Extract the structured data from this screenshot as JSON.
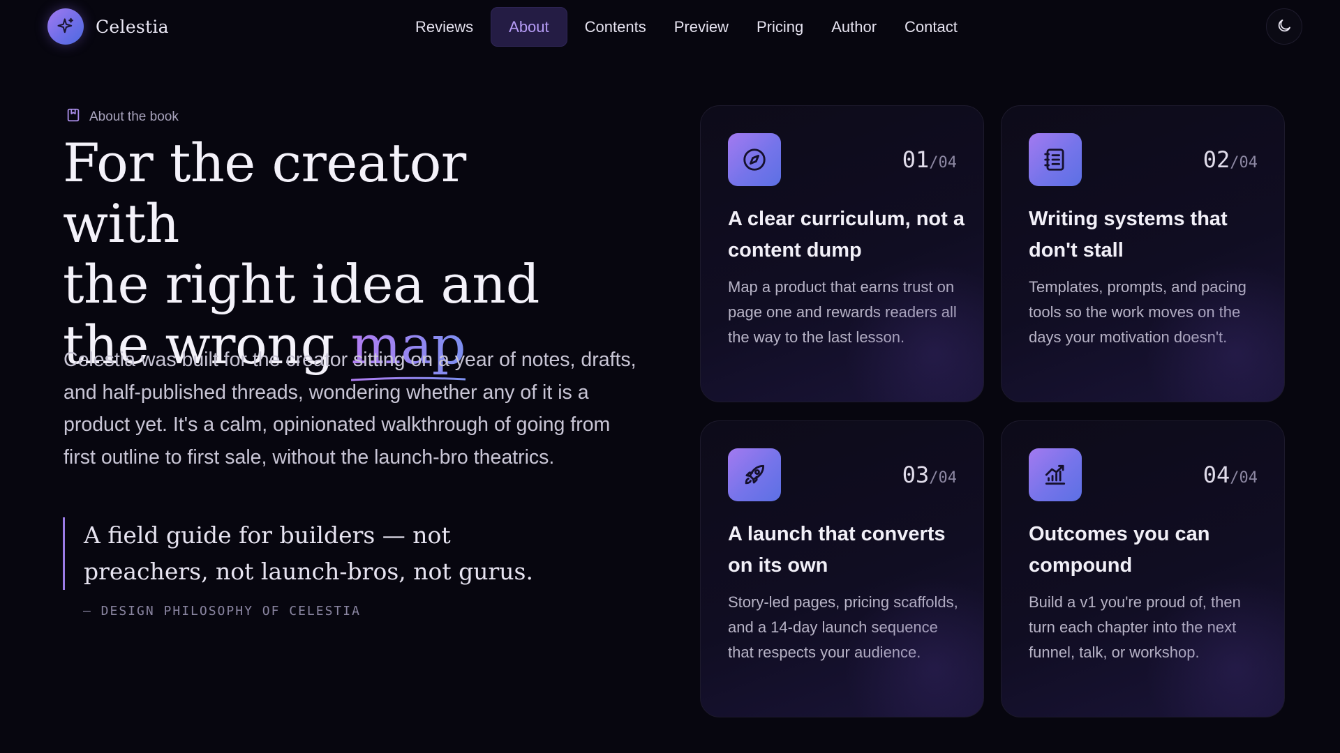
{
  "brand": {
    "name": "Celestia",
    "logo_icon": "sparkle-icon"
  },
  "nav": {
    "links": [
      {
        "label": "Reviews",
        "active": false
      },
      {
        "label": "About",
        "active": true
      },
      {
        "label": "Contents",
        "active": false
      },
      {
        "label": "Preview",
        "active": false
      },
      {
        "label": "Pricing",
        "active": false
      },
      {
        "label": "Author",
        "active": false
      },
      {
        "label": "Contact",
        "active": false
      }
    ],
    "theme_toggle_icon": "moon-icon"
  },
  "about": {
    "eyebrow": "About the book",
    "headline": {
      "line1": "For the creator with",
      "line2": "the right idea and",
      "line3_prefix": "the wrong ",
      "accent_word": "map"
    },
    "intro": "Celestia was built for the creator sitting on a year of notes, drafts, and half-published threads, wondering whether any of it is a product yet. It's a calm, opinionated walkthrough of going from first outline to first sale, without the launch-bro theatrics.",
    "quote": "A field guide for builders — not preachers, not launch-bros, not gurus.",
    "quote_attribution": "— DESIGN PHILOSOPHY OF CELESTIA"
  },
  "cards": [
    {
      "number": "01",
      "total": "/04",
      "icon": "compass-icon",
      "title": "A clear curriculum, not a content dump",
      "body": "Map a product that earns trust on page one and rewards readers all the way to the last lesson."
    },
    {
      "number": "02",
      "total": "/04",
      "icon": "notebook-icon",
      "title": "Writing systems that don't stall",
      "body": "Templates, prompts, and pacing tools so the work moves on the days your motivation doesn't."
    },
    {
      "number": "03",
      "total": "/04",
      "icon": "rocket-icon",
      "title": "A launch that converts on its own",
      "body": "Story-led pages, pricing scaffolds, and a 14-day launch sequence that respects your audience."
    },
    {
      "number": "04",
      "total": "/04",
      "icon": "chart-icon",
      "title": "Outcomes you can compound",
      "body": "Build a v1 you're proud of, then turn each chapter into the next funnel, talk, or workshop."
    }
  ],
  "colors": {
    "background": "#07060f",
    "accent": "#b69cf6",
    "gradient_start": "#a37af0",
    "gradient_end": "#5c70e4"
  }
}
